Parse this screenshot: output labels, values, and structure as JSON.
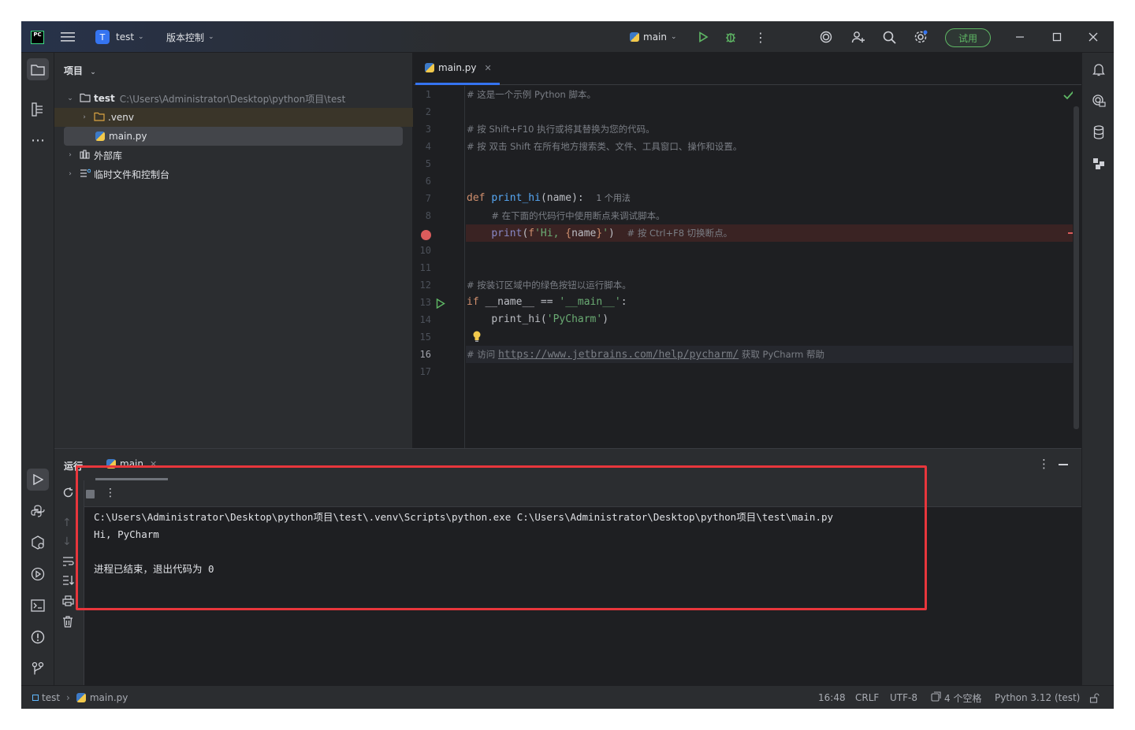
{
  "titlebar": {
    "logo": "PC",
    "project_badge": "T",
    "project_name": "test",
    "vcs_label": "版本控制",
    "run_config": "main",
    "trial_label": "试用",
    "icons": [
      "hamburger-menu-icon",
      "run-icon",
      "debug-icon",
      "more-icon",
      "ai-assistant-icon",
      "add-user-icon",
      "search-icon",
      "settings-icon",
      "minimize-icon",
      "maximize-icon",
      "close-icon"
    ]
  },
  "project_panel": {
    "title": "项目",
    "tree": {
      "root_name": "test",
      "root_path": "C:\\Users\\Administrator\\Desktop\\python项目\\test",
      "venv": ".venv",
      "main_file": "main.py",
      "external_libs": "外部库",
      "scratches": "临时文件和控制台"
    }
  },
  "editor": {
    "tab_label": "main.py",
    "line_numbers": [
      "1",
      "2",
      "3",
      "4",
      "5",
      "6",
      "7",
      "8",
      "9",
      "10",
      "11",
      "12",
      "13",
      "14",
      "15",
      "16",
      "17"
    ],
    "current_line": "16",
    "code": {
      "l1": "# 这是一个示例 Python 脚本。",
      "l3": "# 按 Shift+F10 执行或将其替换为您的代码。",
      "l4": "# 按 双击 Shift 在所有地方搜索类、文件、工具窗口、操作和设置。",
      "l7_kw": "def",
      "l7_fn": "print_hi",
      "l7_rest": "(name):",
      "l7_hint": "1 个用法",
      "l8": "# 在下面的代码行中使用断点来调试脚本。",
      "l9_bi": "print",
      "l9_f": "f",
      "l9_s1": "'Hi, ",
      "l9_br1": "{",
      "l9_var": "name",
      "l9_br2": "}",
      "l9_s2": "'",
      "l9_cm": "# 按 Ctrl+F8 切换断点。",
      "l12": "# 按装订区域中的绿色按钮以运行脚本。",
      "l13_kw": "if",
      "l13_rest": " __name__ == ",
      "l13_str": "'__main__'",
      "l13_colon": ":",
      "l14_call": "print_hi(",
      "l14_str": "'PyCharm'",
      "l14_close": ")",
      "l16_pre": "# 访问 ",
      "l16_link": "https://www.jetbrains.com/help/pycharm/",
      "l16_post": " 获取 PyCharm 帮助"
    }
  },
  "run_panel": {
    "title": "运行",
    "tab_label": "main",
    "output": {
      "line1": "C:\\Users\\Administrator\\Desktop\\python项目\\test\\.venv\\Scripts\\python.exe C:\\Users\\Administrator\\Desktop\\python项目\\test\\main.py",
      "line2": "Hi, PyCharm",
      "line3": "进程已结束，退出代码为 0"
    }
  },
  "statusbar": {
    "crumb_project": "test",
    "crumb_file": "main.py",
    "position": "16:48",
    "line_sep": "CRLF",
    "encoding": "UTF-8",
    "indent": "4 个空格",
    "interpreter": "Python 3.12 (test)"
  },
  "colors": {
    "accent": "#3574f0",
    "highlight_box": "#e8363c",
    "trial_green": "#5fb865",
    "breakpoint": "#db5c5c"
  }
}
